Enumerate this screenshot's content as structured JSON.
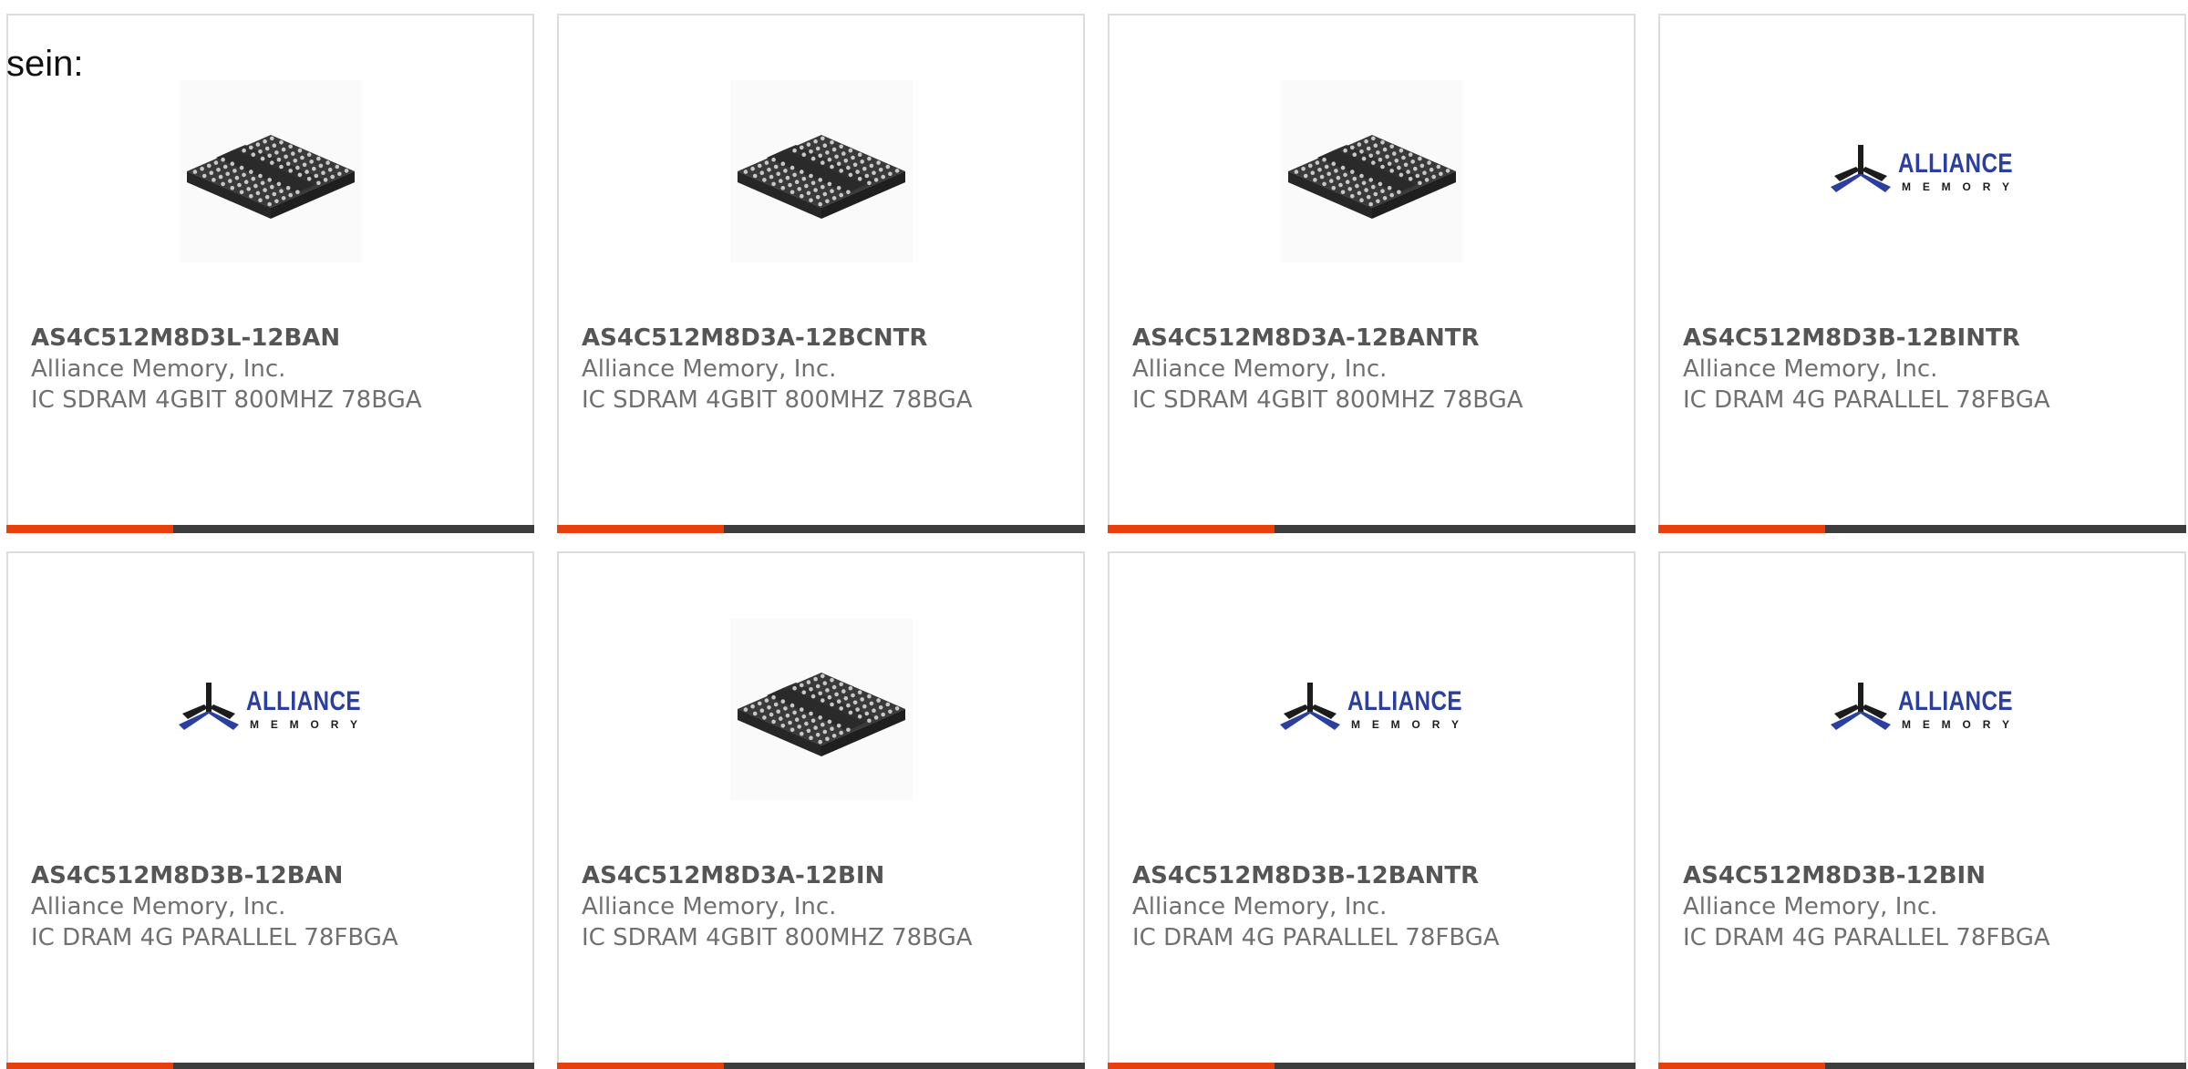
{
  "intro_text": "sein:",
  "colors": {
    "accent": "#e8400c",
    "bar": "#3d3d3d",
    "border": "#dcdcdc",
    "logo_blue": "#2a3fa0",
    "logo_black": "#1c1c1c"
  },
  "products": [
    {
      "part": "AS4C512M8D3L-12BAN",
      "maker": "Alliance Memory, Inc.",
      "desc": "IC SDRAM 4GBIT 800MHZ 78BGA",
      "image": "chip-icon"
    },
    {
      "part": "AS4C512M8D3A-12BCNTR",
      "maker": "Alliance Memory, Inc.",
      "desc": "IC SDRAM 4GBIT 800MHZ 78BGA",
      "image": "chip-icon"
    },
    {
      "part": "AS4C512M8D3A-12BANTR",
      "maker": "Alliance Memory, Inc.",
      "desc": "IC SDRAM 4GBIT 800MHZ 78BGA",
      "image": "chip-icon"
    },
    {
      "part": "AS4C512M8D3B-12BINTR",
      "maker": "Alliance Memory, Inc.",
      "desc": "IC DRAM 4G PARALLEL 78FBGA",
      "image": "alliance-logo"
    },
    {
      "part": "AS4C512M8D3B-12BAN",
      "maker": "Alliance Memory, Inc.",
      "desc": "IC DRAM 4G PARALLEL 78FBGA",
      "image": "alliance-logo"
    },
    {
      "part": "AS4C512M8D3A-12BIN",
      "maker": "Alliance Memory, Inc.",
      "desc": "IC SDRAM 4GBIT 800MHZ 78BGA",
      "image": "chip-icon"
    },
    {
      "part": "AS4C512M8D3B-12BANTR",
      "maker": "Alliance Memory, Inc.",
      "desc": "IC DRAM 4G PARALLEL 78FBGA",
      "image": "alliance-logo"
    },
    {
      "part": "AS4C512M8D3B-12BIN",
      "maker": "Alliance Memory, Inc.",
      "desc": "IC DRAM 4G PARALLEL 78FBGA",
      "image": "alliance-logo"
    }
  ],
  "logo": {
    "word": "ALLIANCE",
    "sub": "MEMORY"
  }
}
